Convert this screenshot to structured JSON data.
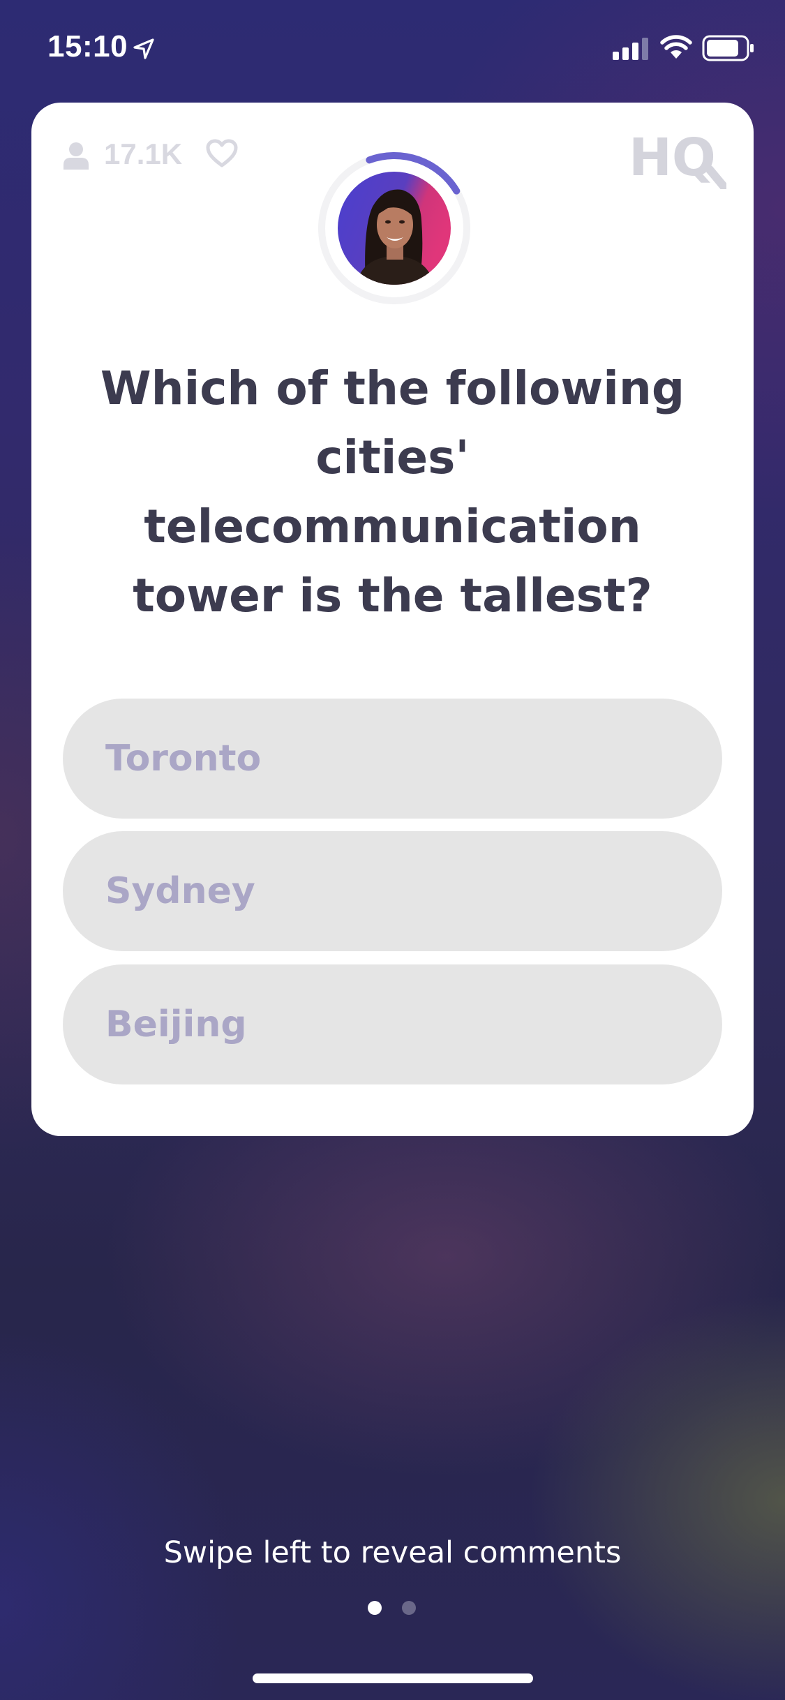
{
  "status_bar": {
    "time": "15:10",
    "icons": [
      "location-arrow-icon",
      "cellular-signal-icon",
      "wifi-icon",
      "battery-icon"
    ]
  },
  "card": {
    "viewer_count": "17.1K",
    "viewer_icon": "person-icon",
    "heart_icon": "heart-outline-icon",
    "logo_text": "HQ",
    "timer_progress": 0.22,
    "question": "Which of the following cities' telecommunication tower is the tallest?",
    "answers": [
      {
        "label": "Toronto"
      },
      {
        "label": "Sydney"
      },
      {
        "label": "Beijing"
      }
    ]
  },
  "footer": {
    "hint": "Swipe left to reveal comments",
    "pages": 2,
    "active_page": 1
  },
  "colors": {
    "question_text": "#3c3b4f",
    "answer_bg": "#e5e5e5",
    "answer_text": "#aaa6c6",
    "timer_ring": "#6a63d0",
    "logo": "#d4d4dc",
    "background_top": "#2d2b73"
  }
}
